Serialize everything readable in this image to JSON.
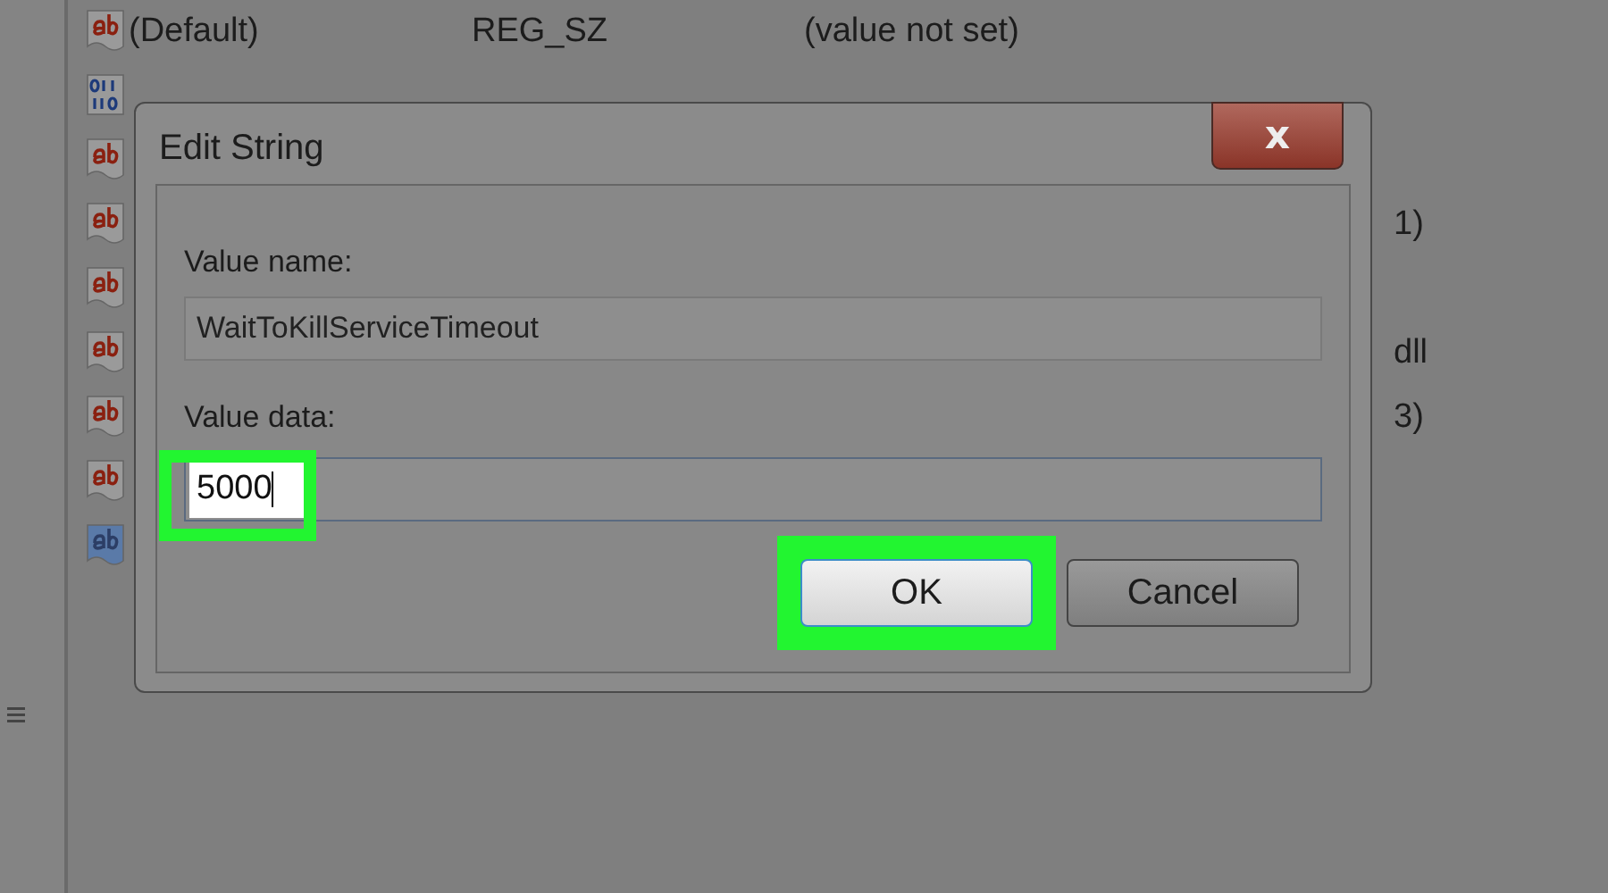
{
  "registry_values": [
    {
      "kind": "string",
      "name": "(Default)",
      "type": "REG_SZ",
      "data": "(value not set)",
      "selected": false
    },
    {
      "kind": "binary",
      "selected": false
    },
    {
      "kind": "string",
      "selected": false
    },
    {
      "kind": "string",
      "data_tail": "1)",
      "selected": false
    },
    {
      "kind": "string",
      "selected": false
    },
    {
      "kind": "string",
      "data_tail": "dll",
      "selected": false
    },
    {
      "kind": "string",
      "data_tail": "3)",
      "selected": false
    },
    {
      "kind": "string",
      "selected": false
    },
    {
      "kind": "string",
      "selected": true
    }
  ],
  "dialog": {
    "title": "Edit String",
    "close": "x",
    "value_name_label": "Value name:",
    "value_name": "WaitToKillServiceTimeout",
    "value_data_label": "Value data:",
    "value_data": "5000",
    "value_data_highlighted": true,
    "buttons": [
      {
        "label": "OK",
        "default": true,
        "highlighted": true
      },
      {
        "label": "Cancel",
        "default": false,
        "highlighted": false
      }
    ]
  }
}
